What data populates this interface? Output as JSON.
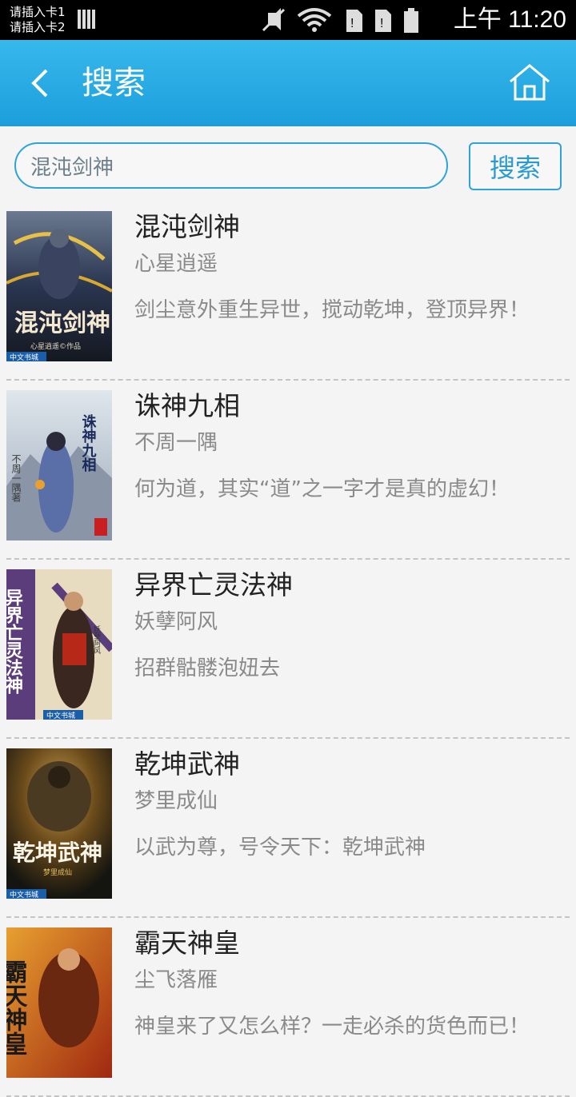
{
  "status_bar": {
    "sim1": "请插入卡1",
    "sim2": "请插入卡2",
    "time": "上午 11:20"
  },
  "header": {
    "title": "搜索",
    "back_icon": "chevron-left-icon",
    "home_icon": "home-icon"
  },
  "search": {
    "value": "混沌剑神",
    "button_label": "搜索"
  },
  "books": [
    {
      "title": "混沌剑神",
      "author": "心星逍遥",
      "desc": "剑尘意外重生异世，搅动乾坤，登顶异界！",
      "cover_text": "混沌剑神",
      "cover_sub": "心星逍遥©作品",
      "cover_brand": "中文书城",
      "cover_colors": [
        "#2a3550",
        "#8a6a3a"
      ]
    },
    {
      "title": "诛神九相",
      "author": "不周一隅",
      "desc": "何为道，其实“道”之一字才是真的虚幻！",
      "cover_text": "诛神九相",
      "cover_sub": "不周一隅著",
      "cover_colors": [
        "#c9d3dc",
        "#6b7fa8"
      ]
    },
    {
      "title": "异界亡灵法神",
      "author": "妖孽阿风",
      "desc": "招群骷髅泡妞去",
      "cover_text": "异界亡灵法神",
      "cover_sub": "妖孽阿风",
      "cover_brand": "中文书城",
      "cover_colors": [
        "#5a3d7a",
        "#c8b890"
      ]
    },
    {
      "title": "乾坤武神",
      "author": "梦里成仙",
      "desc": "以武为尊，号令天下：乾坤武神",
      "cover_text": "乾坤武神",
      "cover_sub": "梦里成仙",
      "cover_brand": "中文书城",
      "cover_colors": [
        "#1a1a14",
        "#7a5a22"
      ]
    },
    {
      "title": "霸天神皇",
      "author": "尘飞落雁",
      "desc": "神皇来了又怎么样？一走必杀的货色而已！",
      "cover_text": "霸天神皇",
      "cover_colors": [
        "#b8421c",
        "#e8a030"
      ]
    }
  ]
}
